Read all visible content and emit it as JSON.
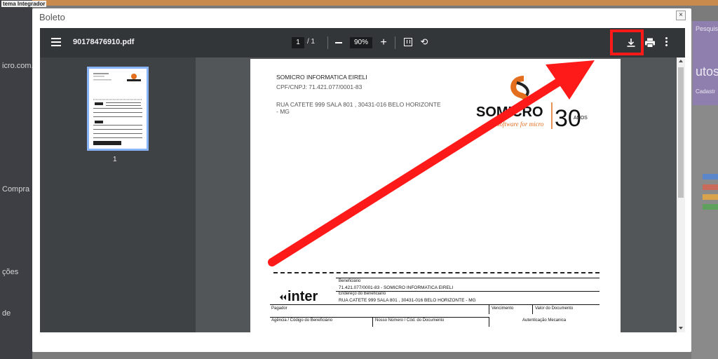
{
  "background": {
    "system_label": "tema Integrador",
    "sidebar_texts": [
      "icro.com.b",
      "Compra",
      "ções",
      "de"
    ],
    "right_texts": {
      "search": "Pesquis",
      "title": "utos",
      "tab": "Cadastr"
    },
    "legend_colors": [
      "#5b86c9",
      "#c96a5a",
      "#d8a34a",
      "#5ea05c"
    ]
  },
  "modal": {
    "title": "Boleto",
    "close_label": "×"
  },
  "viewer": {
    "file_name": "90178476910.pdf",
    "current_page": "1",
    "page_total": "/ 1",
    "zoom": "90%",
    "thumbnail_page": "1"
  },
  "document": {
    "company_name": "SOMICRO INFORMATICA EIRELI",
    "cnpj": "CPF/CNPJ: 71.421.077/0001-83",
    "address": "RUA CATETE 999 SALA 801 , 30431-016 BELO HORIZONTE - MG",
    "logo_brand": "SOMICRO",
    "logo_tagline": "software for micro",
    "logo_years": "30",
    "logo_anos": "ANOS",
    "bank_name": "inter",
    "boleto": {
      "beneficiario_label": "Beneficiário",
      "beneficiario_value": "71.421.077/0001-83 - SOMICRO INFORMATICA EIRELI",
      "endereco_label": "Endereço do Beneficiário",
      "endereco_value": "RUA CATETE 999 SALA 801 , 30431-016 BELO HORIZONTE - MG",
      "pagador_label": "Pagador",
      "vencimento_label": "Vencimento",
      "valor_label": "Valor do Documento",
      "agencia_label": "Agência / Código do Beneficiário",
      "nosso_numero_label": "Nosso Número / Cód. do Documento",
      "autenticacao_label": "Autenticação Mecanica"
    }
  },
  "annotation": {
    "color": "#ff1a1a"
  }
}
